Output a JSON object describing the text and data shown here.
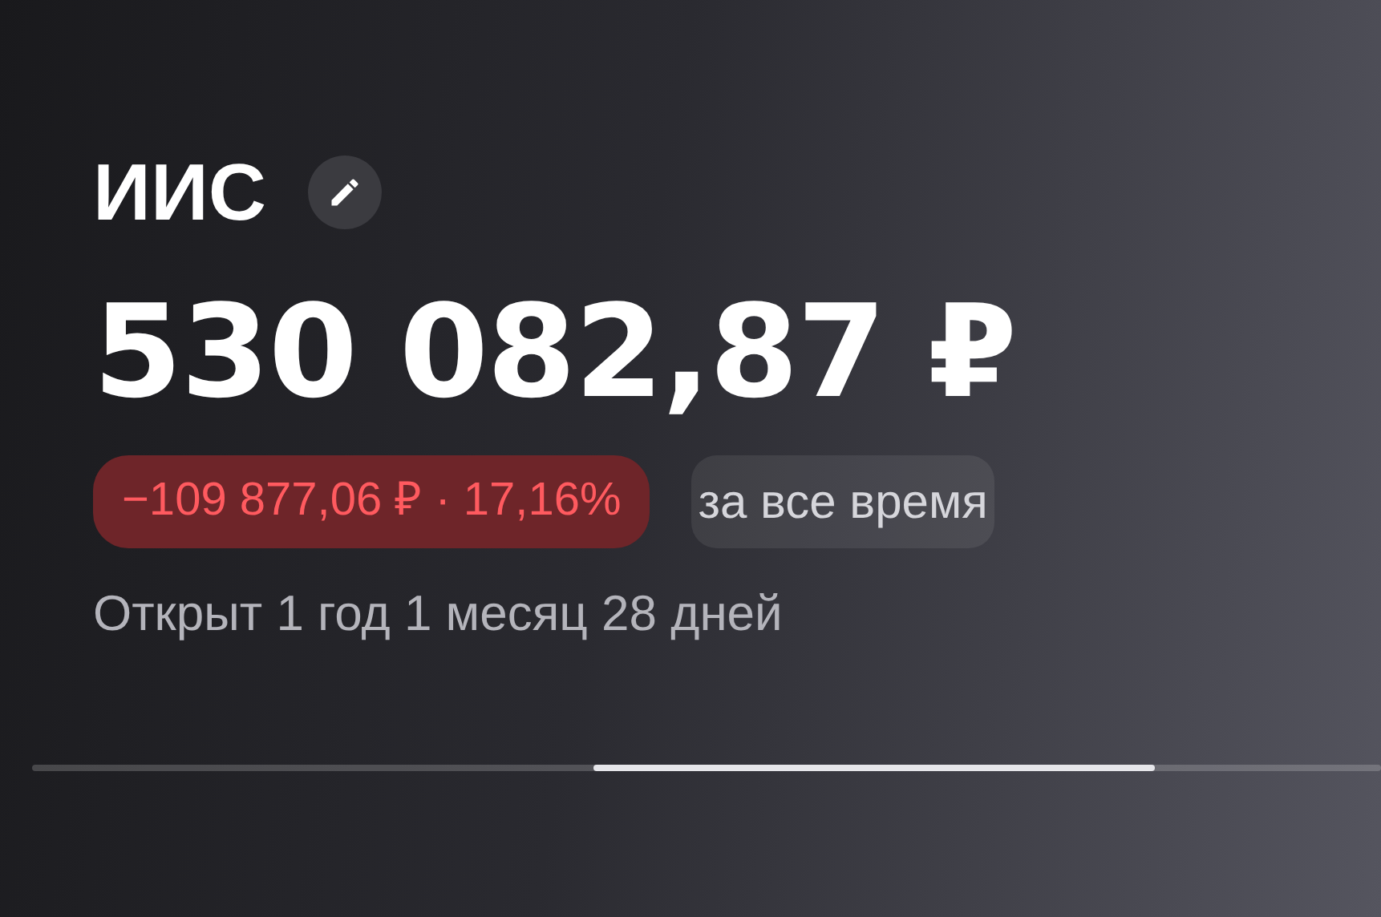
{
  "account": {
    "title": "ИИС",
    "balance": "530 082,87 ₽",
    "change": {
      "text": "−109 877,06 ₽ · 17,16%",
      "negative": true
    },
    "period": {
      "label": "за все время"
    },
    "opened": "Открыт 1 год 1 месяц 28 дней"
  }
}
